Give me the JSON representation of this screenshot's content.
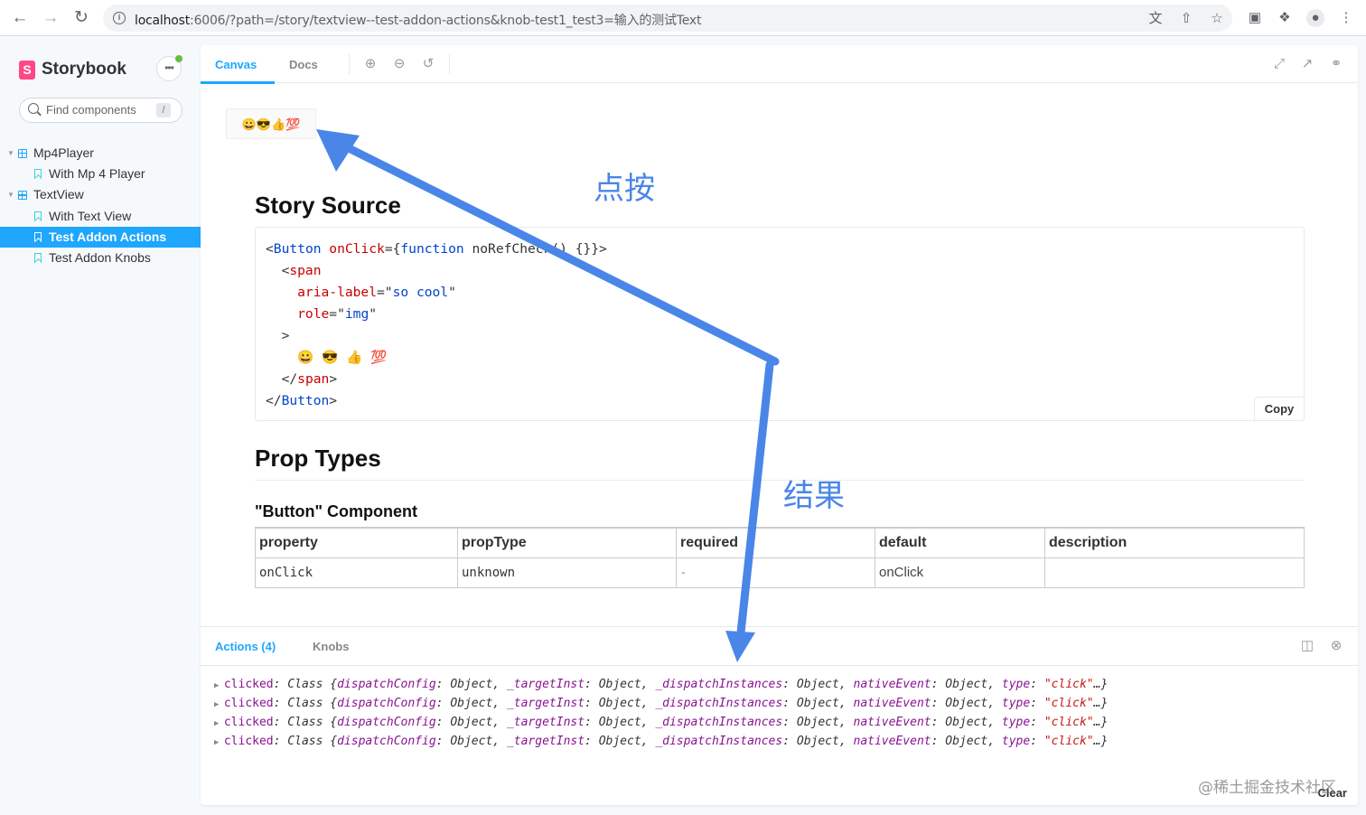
{
  "browser": {
    "url_host": "localhost",
    "url_rest": ":6006/?path=/story/textview--test-addon-actions&knob-test1_test3=输入的测试Text"
  },
  "sidebar": {
    "brand": "Storybook",
    "search_placeholder": "Find components",
    "search_shortcut": "/",
    "tree": [
      {
        "type": "component",
        "label": "Mp4Player"
      },
      {
        "type": "story",
        "label": "With Mp 4 Player"
      },
      {
        "type": "component",
        "label": "TextView"
      },
      {
        "type": "story",
        "label": "With Text View"
      },
      {
        "type": "story",
        "label": "Test Addon Actions",
        "selected": true
      },
      {
        "type": "story",
        "label": "Test Addon Knobs"
      }
    ]
  },
  "toolbar": {
    "tabs": [
      "Canvas",
      "Docs"
    ],
    "active_tab": "Canvas"
  },
  "preview": {
    "button_emoji": "😀😎👍💯"
  },
  "docs": {
    "story_source_heading": "Story Source",
    "code": {
      "line1_open": "<",
      "line1_tag": "Button",
      "line1_attr": " onClick",
      "line1_eq": "={",
      "line1_kw": "function",
      "line1_rest": " noRefCheck() {}}>",
      "line2_open": "  <",
      "line2_tag": "span",
      "line3_attr": "    aria-label",
      "line3_eq": "=\"",
      "line3_val": "so cool",
      "line3_close": "\"",
      "line4_attr": "    role",
      "line4_eq": "=\"",
      "line4_val": "img",
      "line4_close": "\"",
      "line5": "  >",
      "line6": "    😀 😎 👍 💯",
      "line7_open": "  </",
      "line7_tag": "span",
      "line7_close": ">",
      "line8_open": "</",
      "line8_tag": "Button",
      "line8_close": ">"
    },
    "copy_label": "Copy",
    "prop_types_heading": "Prop Types",
    "component_heading": "\"Button\" Component",
    "table": {
      "headers": [
        "property",
        "propType",
        "required",
        "default",
        "description"
      ],
      "rows": [
        [
          "onClick",
          "unknown",
          "-",
          "onClick",
          ""
        ]
      ]
    }
  },
  "addons": {
    "actions_tab": "Actions (4)",
    "knobs_tab": "Knobs",
    "clear_label": "Clear",
    "log_entry": {
      "name": "clicked",
      "class": "Class",
      "k1": "dispatchConfig",
      "k2": "_targetInst",
      "k3": "_dispatchInstances",
      "k4": "nativeEvent",
      "k5": "type",
      "obj": "Object",
      "str": "\"click\"",
      "ellipsis": "…}"
    },
    "log_count": 4
  },
  "annotations": {
    "click_label": "点按",
    "result_label": "结果",
    "arrow_color": "#4a86e8"
  },
  "watermark": "@稀土掘金技术社区"
}
